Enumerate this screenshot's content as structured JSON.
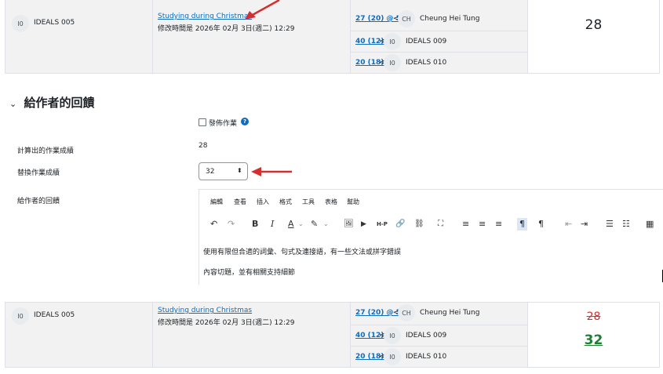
{
  "top_row": {
    "user": {
      "initials": "I0",
      "name": "IDEALS 005"
    },
    "submission": {
      "title": "Studying during Christmas",
      "modified": "修改時間是 2026年 02月 3日(週二) 12:29"
    },
    "peers": [
      {
        "link": "27 (20) @ 5",
        "lt": "<",
        "initials": "CH",
        "name": "Cheung Hei Tung"
      },
      {
        "link": "40 (12)",
        "lt": "<",
        "initials": "I0",
        "name": "IDEALS 009"
      },
      {
        "link": "20 (18)",
        "lt": "<",
        "initials": "I0",
        "name": "IDEALS 010"
      }
    ],
    "grade": "28"
  },
  "feedback": {
    "section_title": "給作者的回饋",
    "chevron_icon": "chevron-down-icon",
    "publish_label": "發佈作業",
    "help_icon": "?",
    "calc_label": "計算出的作業成績",
    "calc_value": "28",
    "override_label": "替換作業成績",
    "override_value": "32",
    "feedback_label": "給作者的回饋",
    "editor": {
      "menu": [
        "編輯",
        "查看",
        "插入",
        "格式",
        "工具",
        "表格",
        "幫助"
      ],
      "toolbar": {
        "undo": "↶",
        "redo": "↷",
        "bold": "B",
        "italic": "I",
        "font_color": "A",
        "highlight": "✎",
        "image": "🖼",
        "media": "▶",
        "h5p": "H-P",
        "link": "🔗",
        "unlink": "⛓",
        "fullscreen": "⛶",
        "align_left": "≡",
        "align_center": "≡",
        "align_right": "≡",
        "ltr": "¶",
        "rtl": "¶",
        "outdent": "⇤",
        "indent": "⇥",
        "bullets": "☰",
        "numbers": "☷",
        "calculator": "▦"
      },
      "content": [
        "使用有限但合適的詞彙、句式及連接語，有一些文法或拼字錯誤",
        "內容切題，並有相關支持細節"
      ]
    }
  },
  "bottom_row": {
    "user": {
      "initials": "I0",
      "name": "IDEALS 005"
    },
    "submission": {
      "title": "Studying during Christmas",
      "modified": "修改時間是 2026年 02月 3日(週二) 12:29"
    },
    "peers": [
      {
        "link": "27 (20) @ 5",
        "lt": "<",
        "initials": "CH",
        "name": "Cheung Hei Tung"
      },
      {
        "link": "40 (12)",
        "lt": "<",
        "initials": "I0",
        "name": "IDEALS 009"
      },
      {
        "link": "20 (18)",
        "lt": "<",
        "initials": "I0",
        "name": "IDEALS 010"
      }
    ],
    "old_grade": "28",
    "new_grade": "32"
  },
  "colors": {
    "annotation_arrow": "#d32f2f",
    "link": "#0f6cbf",
    "old_grade": "#d32f2f",
    "new_grade": "#1e7e34"
  }
}
